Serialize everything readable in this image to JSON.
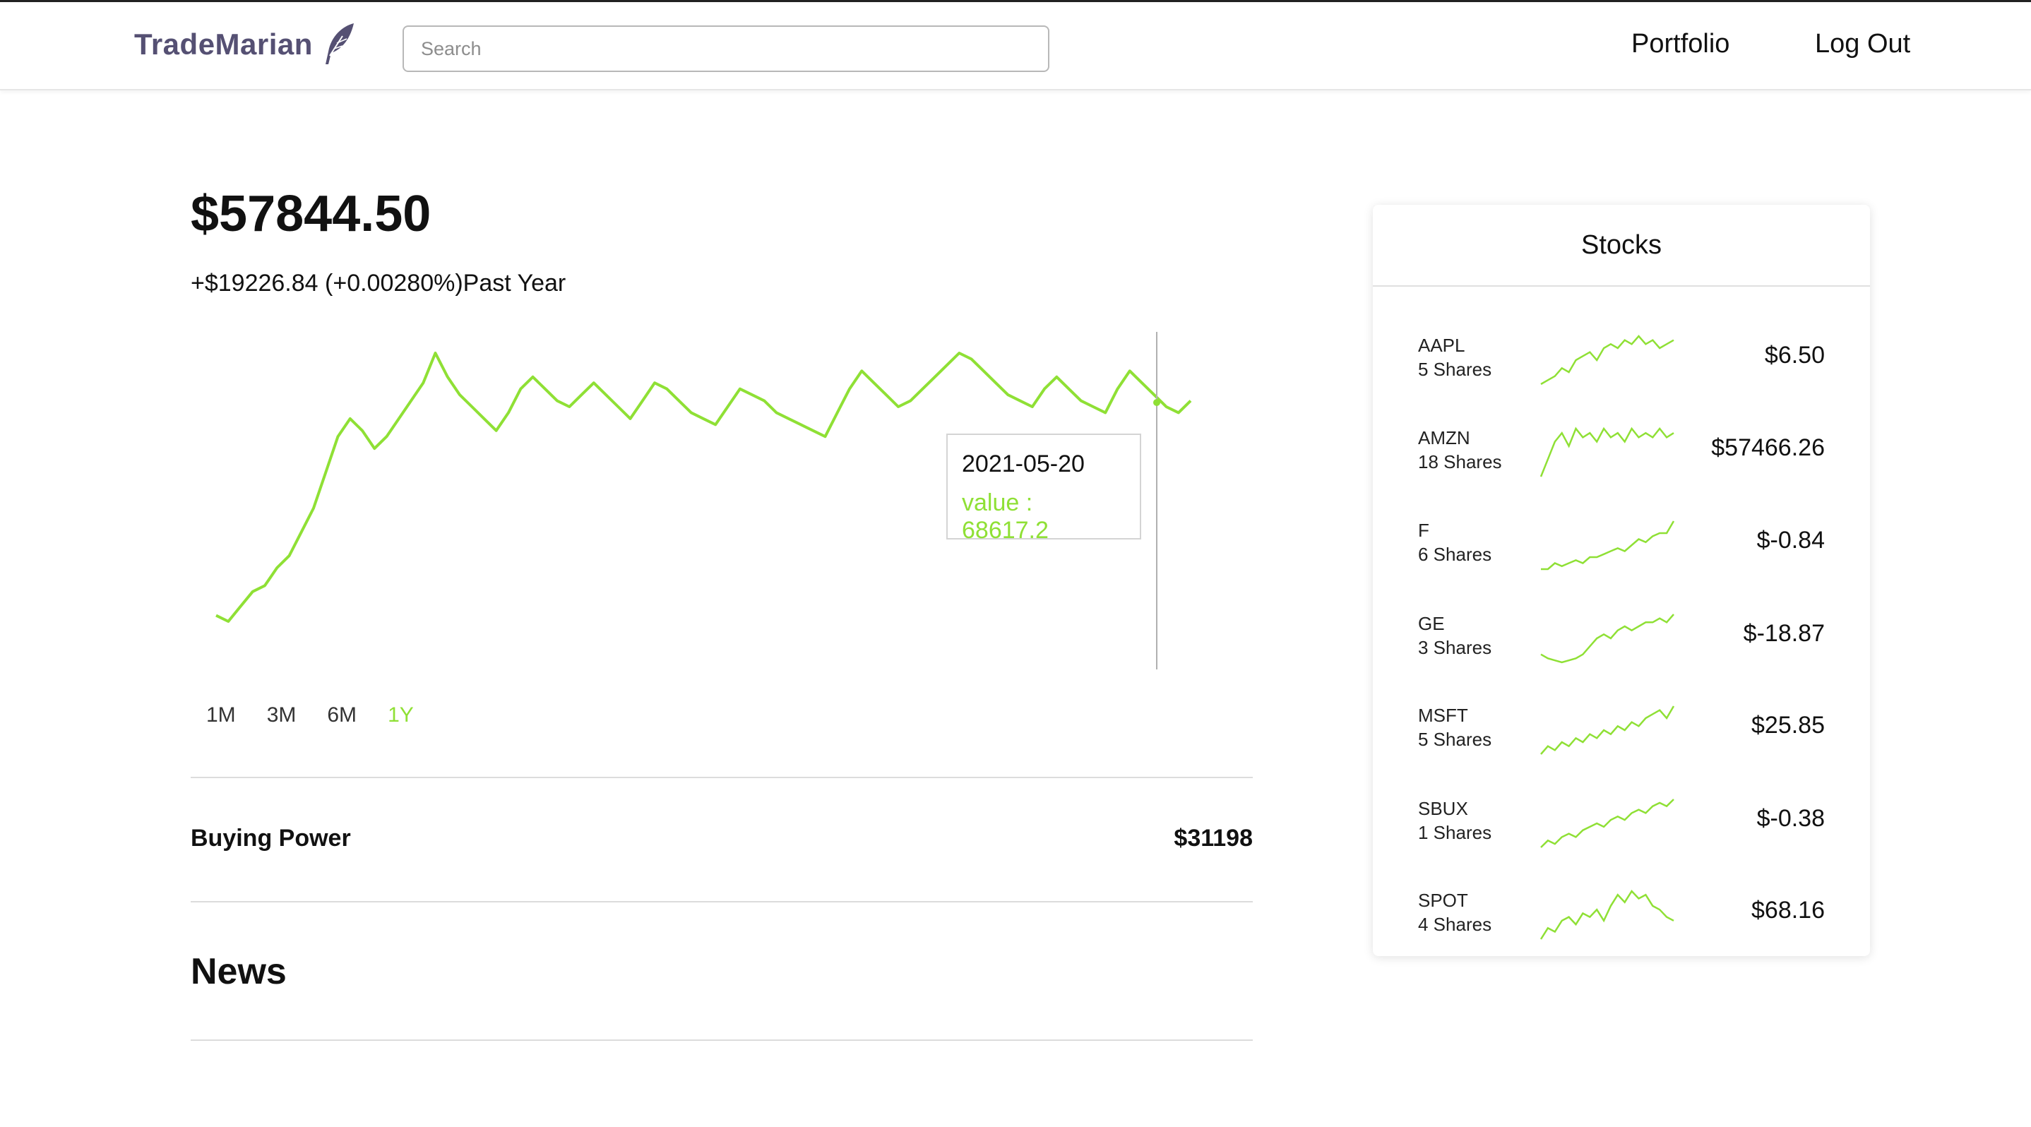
{
  "nav": {
    "brand": "TradeMarian",
    "search_placeholder": "Search",
    "portfolio_label": "Portfolio",
    "logout_label": "Log Out"
  },
  "summary": {
    "value": "$57844.50",
    "change": "+$19226.84 (+0.00280%)Past Year"
  },
  "tooltip": {
    "date": "2021-05-20",
    "value_text": "value : 68617.2"
  },
  "chart_data": {
    "type": "line",
    "series": [
      {
        "values": [
          52,
          50,
          55,
          60,
          62,
          68,
          72,
          80,
          88,
          100,
          112,
          118,
          114,
          108,
          112,
          118,
          124,
          130,
          140,
          132,
          126,
          122,
          118,
          114,
          120,
          128,
          132,
          128,
          124,
          122,
          126,
          130,
          126,
          122,
          118,
          124,
          130,
          128,
          124,
          120,
          118,
          116,
          122,
          128,
          126,
          124,
          120,
          118,
          116,
          114,
          112,
          120,
          128,
          134,
          130,
          126,
          122,
          124,
          128,
          132,
          136,
          140,
          138,
          134,
          130,
          126,
          124,
          122,
          128,
          132,
          128,
          124,
          122,
          120,
          128,
          134,
          130,
          126,
          122,
          120,
          124
        ]
      }
    ]
  },
  "ranges": [
    "1M",
    "3M",
    "6M",
    "1Y"
  ],
  "active_range": "1Y",
  "accent_color": "#8fe035",
  "buying_power": {
    "label": "Buying Power",
    "value": "$31198"
  },
  "news": {
    "title": "News"
  },
  "stocks": {
    "title": "Stocks",
    "items": [
      {
        "symbol": "AAPL",
        "shares": "5 Shares",
        "price": "$6.50",
        "spark": [
          10,
          12,
          14,
          18,
          16,
          22,
          24,
          26,
          22,
          28,
          30,
          28,
          32,
          30,
          34,
          30,
          32,
          28,
          30,
          32
        ]
      },
      {
        "symbol": "AMZN",
        "shares": "18 Shares",
        "price": "$57466.26",
        "spark": [
          12,
          20,
          28,
          32,
          26,
          34,
          30,
          32,
          28,
          34,
          30,
          32,
          28,
          34,
          30,
          32,
          30,
          34,
          30,
          32
        ]
      },
      {
        "symbol": "F",
        "shares": "6 Shares",
        "price": "$-0.84",
        "spark": [
          10,
          10,
          12,
          11,
          12,
          13,
          12,
          14,
          14,
          15,
          16,
          17,
          16,
          18,
          20,
          19,
          21,
          22,
          22,
          26
        ]
      },
      {
        "symbol": "GE",
        "shares": "3 Shares",
        "price": "$-18.87",
        "spark": [
          14,
          12,
          11,
          10,
          11,
          12,
          14,
          18,
          22,
          24,
          22,
          26,
          28,
          26,
          28,
          30,
          30,
          32,
          30,
          34
        ]
      },
      {
        "symbol": "MSFT",
        "shares": "5 Shares",
        "price": "$25.85",
        "spark": [
          10,
          14,
          12,
          16,
          14,
          18,
          16,
          20,
          18,
          22,
          20,
          24,
          22,
          26,
          24,
          28,
          30,
          32,
          28,
          34
        ]
      },
      {
        "symbol": "SBUX",
        "shares": "1 Shares",
        "price": "$-0.38",
        "spark": [
          10,
          12,
          11,
          13,
          14,
          13,
          15,
          16,
          17,
          16,
          18,
          19,
          18,
          20,
          21,
          20,
          22,
          23,
          22,
          24
        ]
      },
      {
        "symbol": "SPOT",
        "shares": "4 Shares",
        "price": "$68.16",
        "spark": [
          10,
          16,
          14,
          20,
          22,
          18,
          24,
          22,
          26,
          20,
          28,
          34,
          30,
          36,
          32,
          34,
          28,
          26,
          22,
          20
        ]
      }
    ]
  }
}
